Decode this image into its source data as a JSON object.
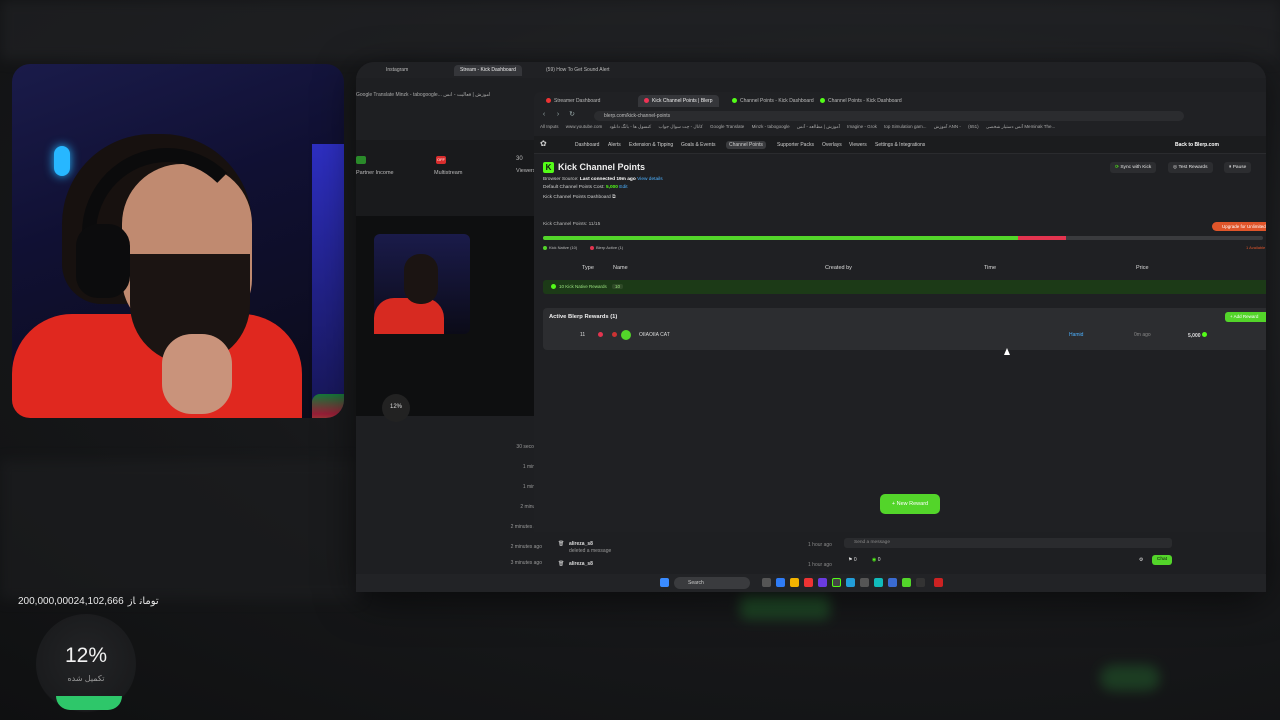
{
  "overlay": {
    "goal_current": "24,102,666",
    "goal_separator": "از",
    "goal_total": "200,000,000تومان",
    "percent": "12%",
    "percent_label": "تکمیل شده"
  },
  "outer_browser": {
    "tabs": [
      "Instagram",
      "Stream - Kick Dashboard",
      "(59) How To Get Sound Alert"
    ],
    "bookmarks": "Google Translate  Minzk - tabogoogle...  آموزش | فعالیت - آنس",
    "dash_items": [
      "Partner Income",
      "Multistream",
      "Viewers"
    ],
    "dash_viewers_value": "30",
    "dash_badge_off": "OFF",
    "preview_percent": "12%",
    "log_times": [
      "30 seconds",
      "1 minute",
      "1 minute",
      "2 minutes",
      "2 minutes ago",
      "2 minutes ago",
      "3 minutes ago"
    ]
  },
  "inner_browser": {
    "tabs": [
      "Streamer Dashboard",
      "Kick Channel Points | Blerp",
      "Channel Points - Kick Dashboard",
      "Channel Points - Kick Dashboard"
    ],
    "url": "blerp.com/kick-channel-points",
    "bookmarks": [
      "All Inputs",
      "www.youtube.com",
      "کانال - چت سوال جواب",
      "کنسول ها - بانگ دانلود",
      "Google Translate",
      "Minzk - tabogoogle",
      "آموزش | مطالعه - آنس",
      "Imagine - Grok",
      "top Simulation gam...",
      "آموزش ANN - آنس",
      "دستیار شخصی",
      "(651) Meminak The..."
    ],
    "nav": [
      "Dashboard",
      "Alerts",
      "Extension & Tipping",
      "Goals & Events",
      "Channel Points",
      "Supporter Packs",
      "Overlays",
      "Viewers",
      "Settings & Integrations"
    ],
    "back_link": "Back to Blerp.com"
  },
  "page": {
    "title": "Kick Channel Points",
    "browser_source_label": "Browser Source:",
    "browser_source_value": "Last connected 19m ago",
    "view_details": "View details",
    "default_cost_label": "Default Channel Points Cost:",
    "default_cost_value": "5,000",
    "edit": "Edit",
    "dashboard_link": "Kick Channel Points Dashboard",
    "sync_btn": "Sync with Kick",
    "test_btn": "Test Rewards",
    "pause_btn": "Pause",
    "upgrade_btn": "Upgrade for Unlimited",
    "points_count": "Kick Channel Points: 11/15",
    "legend_native": "Kick Native (10)",
    "legend_blerp": "Blerp Active (1)",
    "legend_right": "1 Available",
    "columns": [
      "Type",
      "Name",
      "Created by",
      "Time",
      "Price"
    ],
    "native_row": "10 Kick Native Rewards",
    "native_badge": "10",
    "active_title": "Active Blerp Rewards (1)",
    "add_reward": "+ Add Reward",
    "reward": {
      "index": "11",
      "name": "OIIAOIIA CAT",
      "created_by": "Hamid",
      "time": "0m ago",
      "price": "5,000"
    },
    "new_reward": "New Reward"
  },
  "chat": {
    "rows": [
      {
        "user": "alireza_s8",
        "action": "deleted a message",
        "time": "1 hour ago"
      },
      {
        "user": "alireza_s8",
        "action": "",
        "time": "1 hour ago"
      }
    ],
    "placeholder": "Send a message",
    "points": "0",
    "viewers": "0",
    "send": "Chat"
  },
  "taskbar": {
    "search": "Search"
  },
  "colors": {
    "kick_green": "#53fc18",
    "accent_green": "#53d52a",
    "red": "#e3344f",
    "orange": "#e0552a"
  },
  "progress": {
    "native_fraction": 0.66,
    "blerp_fraction": 0.066
  }
}
